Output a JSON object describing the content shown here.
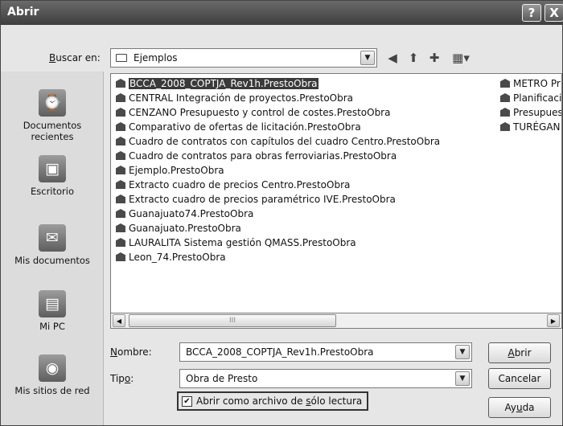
{
  "window": {
    "title": "Abrir",
    "help_button": "?",
    "close_button": "X"
  },
  "look_in": {
    "label": "Buscar en:",
    "value": "Ejemplos"
  },
  "places": [
    {
      "label": "Documentos recientes",
      "icon": "recent-documents-icon"
    },
    {
      "label": "Escritorio",
      "icon": "desktop-icon"
    },
    {
      "label": "Mis documentos",
      "icon": "my-documents-icon"
    },
    {
      "label": "Mi PC",
      "icon": "my-computer-icon"
    },
    {
      "label": "Mis sitios de red",
      "icon": "network-places-icon"
    }
  ],
  "files_col1": [
    "BCCA_2008_COPTJA_Rev1h.PrestoObra",
    "CENTRAL Integración de proyectos.PrestoObra",
    "CENZANO Presupuesto y control de costes.PrestoObra",
    "Comparativo de ofertas de licitación.PrestoObra",
    "Cuadro de contratos con capítulos del cuadro Centro.PrestoObra",
    "Cuadro de contratos para obras ferroviarias.PrestoObra",
    "Ejemplo.PrestoObra",
    "Extracto cuadro de precios Centro.PrestoObra",
    "Extracto cuadro de precios paramétrico IVE.PrestoObra",
    "Guanajuato74.PrestoObra",
    "Guanajuato.PrestoObra",
    "LAURALITA Sistema gestión QMASS.PrestoObra",
    "Leon_74.PrestoObra"
  ],
  "files_col2": [
    "METRO Pr",
    "Planificaci",
    "Presupues",
    "TURÉGAN"
  ],
  "selected_file_index": 0,
  "filename": {
    "label": "Nombre:",
    "value": "BCCA_2008_COPTJA_Rev1h.PrestoObra"
  },
  "filetype": {
    "label": "Tipo:",
    "value": "Obra de Presto"
  },
  "readonly": {
    "label": "Abrir como archivo de sólo lectura",
    "checked": true
  },
  "buttons": {
    "open": "Abrir",
    "cancel": "Cancelar",
    "help": "Ayuda"
  },
  "scrollbar": {
    "thumb_grip": "III"
  }
}
